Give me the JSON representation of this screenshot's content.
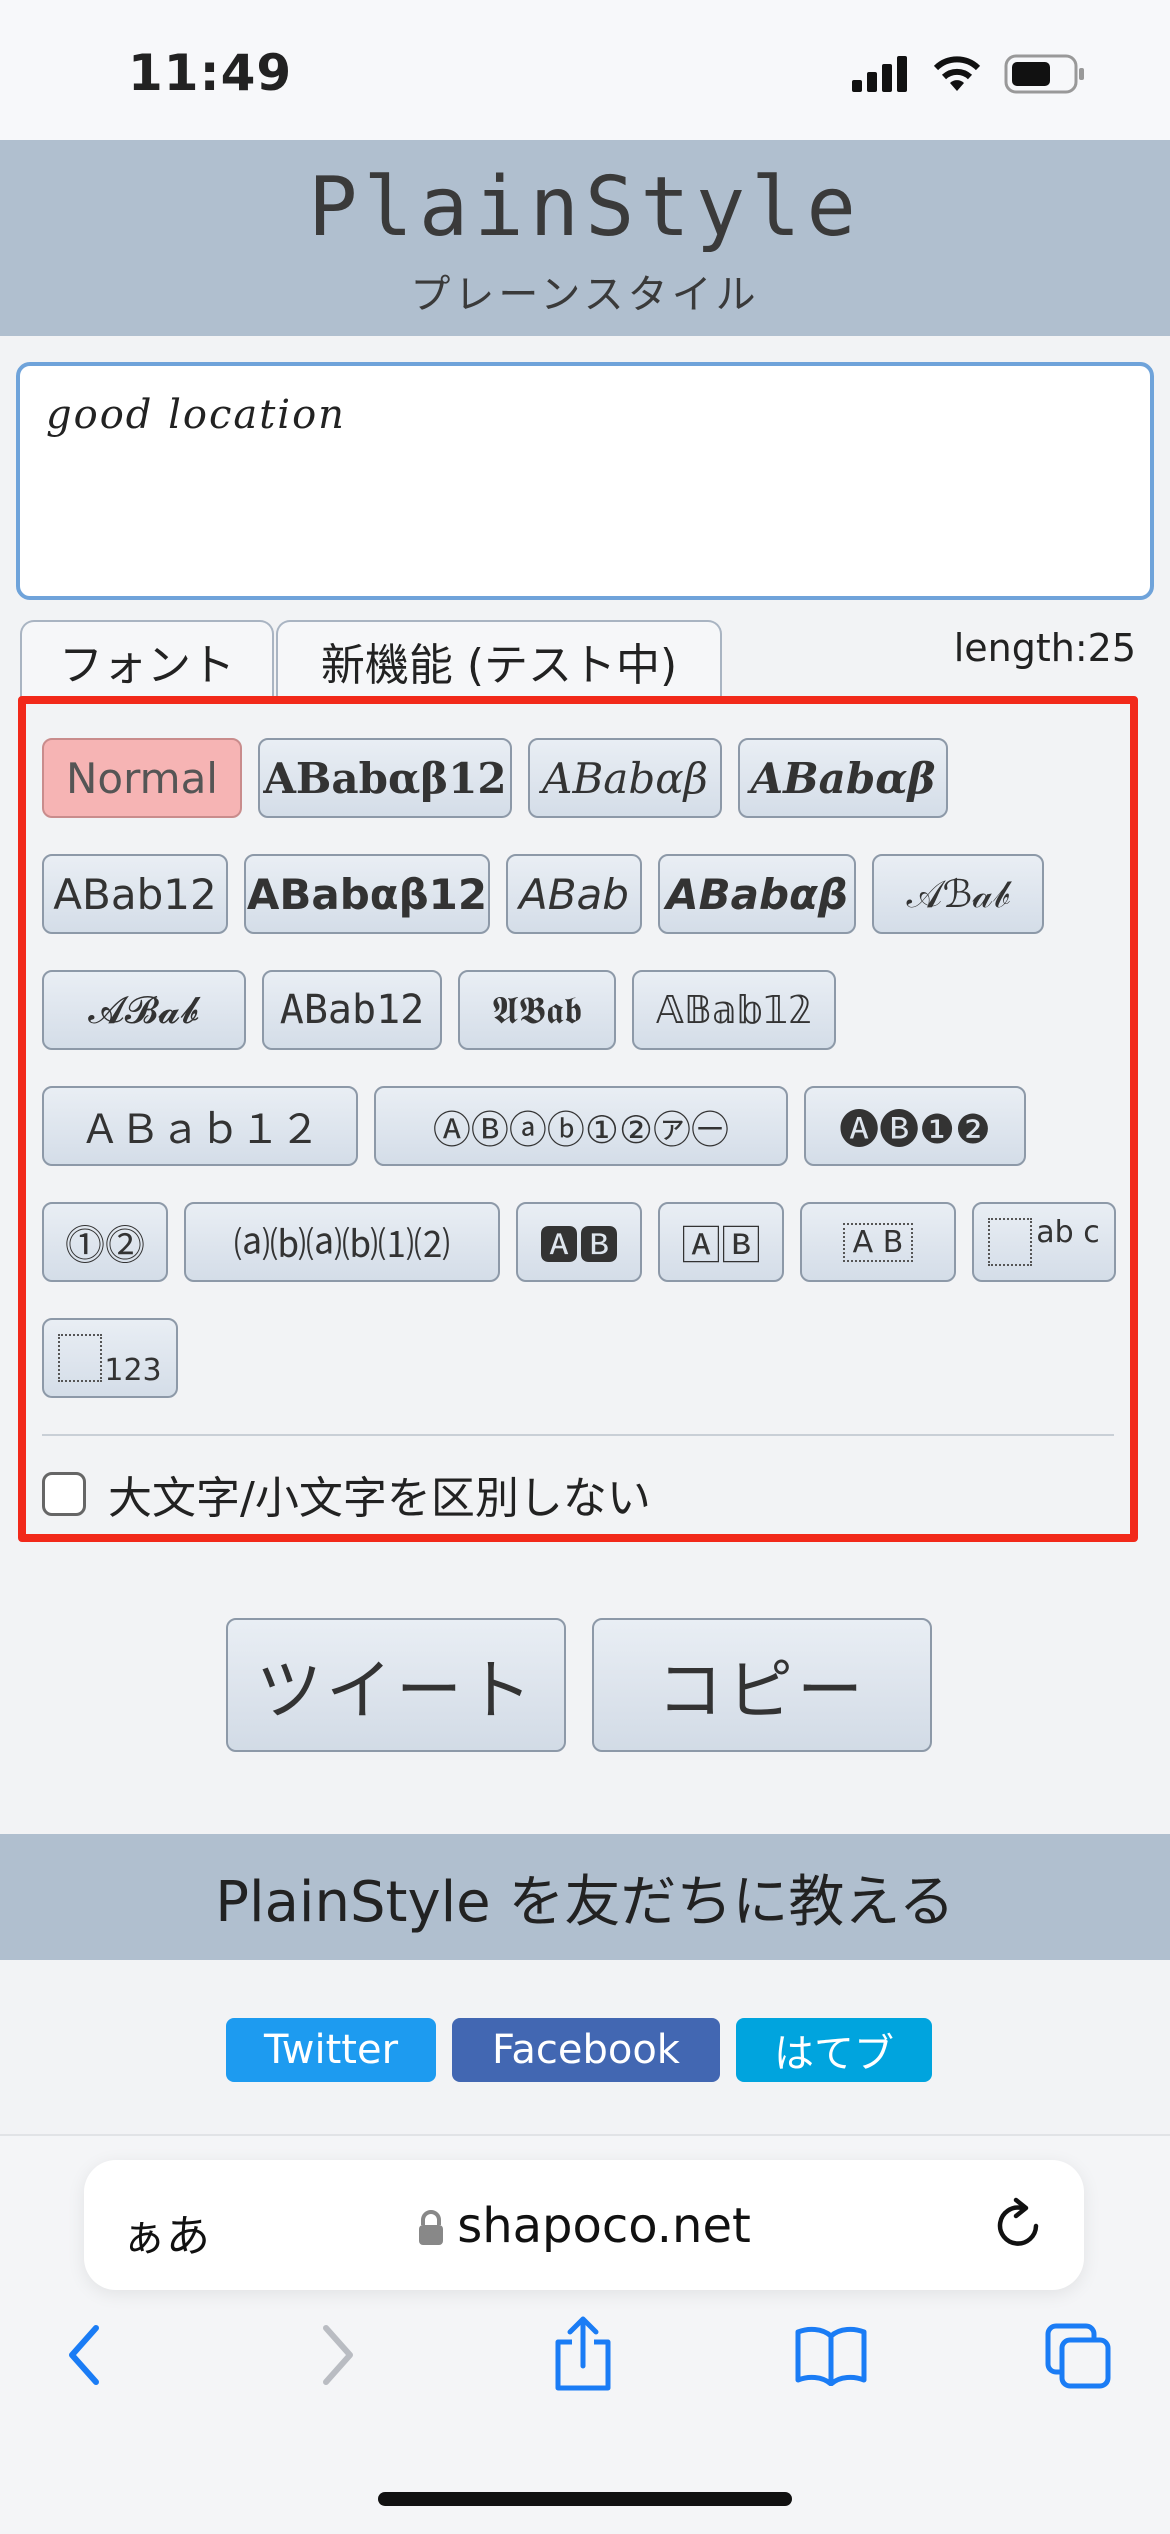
{
  "status_bar": {
    "time": "11:49"
  },
  "header": {
    "logo": "PlainStyle",
    "logo_sub": "プレーンスタイル"
  },
  "input": {
    "value": "good location"
  },
  "tabs": [
    {
      "label": "フォント"
    },
    {
      "label": "新機能 (テスト中)"
    }
  ],
  "length": "length:25",
  "font_buttons": [
    "Normal",
    "ABabαβ12",
    "ABabαβ",
    "ABabαβ",
    "ABab12",
    "ABabαβ12",
    "ABab",
    "ABabαβ",
    "𝒜ℬ𝒶𝒷",
    "𝓐𝓑𝓪𝓫",
    "ABab12",
    "𝕬𝕭𝖆𝖇",
    "𝔸𝔹𝕒𝕓𝟙𝟚",
    "ＡＢａｂ１２",
    "ⒶⒷⓐⓑ①②㋐㊀",
    "🅐🅑❶❷",
    "⓵⓶",
    "⒜⒝⒜⒝⑴⑵",
    "🅰🅱",
    "🄰🄱",
    "A B",
    "ab c",
    "123"
  ],
  "checkbox_label": "大文字/小文字を区別しない",
  "actions": {
    "tweet": "ツイート",
    "copy": "コピー"
  },
  "share": {
    "banner": "PlainStyle を友だちに教える",
    "twitter": "Twitter",
    "facebook": "Facebook",
    "hatena": "はてブ",
    "colors": {
      "twitter": "#1d9bf0",
      "facebook": "#4267b2",
      "hatena": "#00a4de"
    }
  },
  "browser": {
    "aa": "ぁあ",
    "url": "shapoco.net"
  }
}
